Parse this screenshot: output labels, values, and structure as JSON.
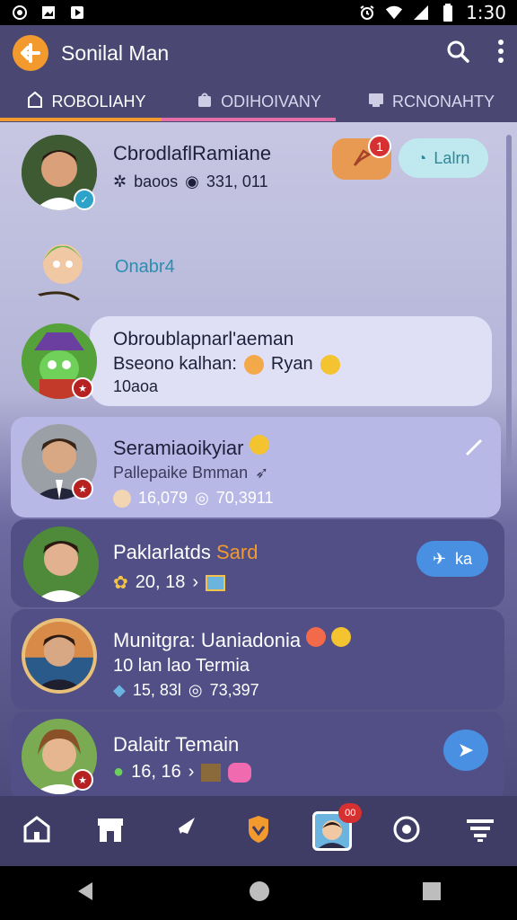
{
  "status_bar": {
    "time": "1:30",
    "left_icons": [
      "circle-icon",
      "image-icon",
      "play-icon"
    ],
    "right_icons": [
      "alarm-icon",
      "wifi-icon",
      "signal-icon",
      "battery-icon"
    ]
  },
  "app": {
    "title": "Sonilal Man"
  },
  "tabs": [
    {
      "label": "ROBOLIAHY",
      "icon": "home-outline-icon"
    },
    {
      "label": "ODIHOIVANY",
      "icon": "bag-icon"
    },
    {
      "label": "RCNONAHTY",
      "icon": "folder-icon"
    }
  ],
  "rows": [
    {
      "name": "CbrodlaflRamiane",
      "sub_a": "baoos",
      "sub_b": "331, 011",
      "badge_count": "1",
      "chip_label": "Lalrn"
    },
    {
      "name": "Onabr4"
    },
    {
      "name": "Obroublapnarl'aeman",
      "line2": "Bseono kalhan:",
      "line2b": "Ryan",
      "line3": "10aoa"
    },
    {
      "name": "Seramiaoikyiar",
      "line2": "Pallepaike Bmman",
      "stat_a": "16,079",
      "stat_b": "70,3911"
    },
    {
      "name": "Paklarlatds",
      "name_accent": "Sard",
      "stat_a": "20, 18",
      "chip_label": "ka"
    },
    {
      "name": "Munitgra: Uaniadonia",
      "line2": "10 lan lao Termia",
      "stat_a": "15, 83l",
      "stat_b": "73,397"
    },
    {
      "name": "Dalaitr Temain",
      "stat_a": "16, 16"
    }
  ],
  "nav": {
    "items": [
      "home-icon",
      "store-icon",
      "rocket-icon",
      "shield-icon",
      "profile-icon",
      "circle-icon",
      "filter-icon"
    ],
    "profile_badge": "00"
  },
  "colors": {
    "appbar": "#4a4872",
    "accent_orange": "#f29a2e",
    "accent_pink": "#e46fa6",
    "selected_card": "#b8b8e6",
    "dark_card": "#514f86",
    "chip_teal": "#bfe9ef",
    "chip_blue": "#4a90e2"
  }
}
